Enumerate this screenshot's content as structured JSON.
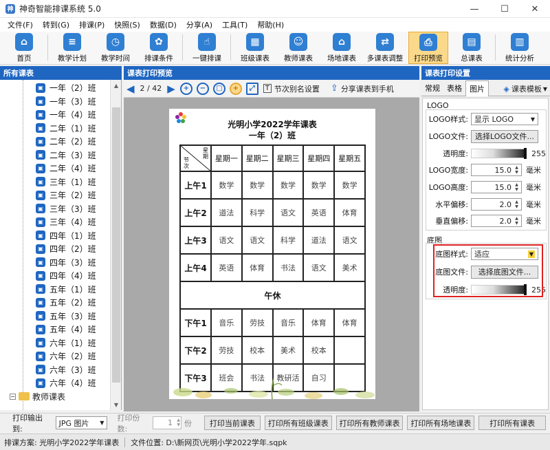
{
  "window": {
    "title": "神奇智能排课系统 5.0"
  },
  "menu": [
    "文件(F)",
    "转到(G)",
    "排课(P)",
    "快照(S)",
    "数据(D)",
    "分享(A)",
    "工具(T)",
    "帮助(H)"
  ],
  "toolbar": [
    {
      "label": "首页",
      "icon": "home-icon"
    },
    {
      "label": "教学计划",
      "icon": "plan-icon"
    },
    {
      "label": "教学时间",
      "icon": "clock-icon"
    },
    {
      "label": "排课条件",
      "icon": "conditions-icon"
    },
    {
      "label": "一键排课",
      "icon": "click-icon"
    },
    {
      "label": "班级课表",
      "icon": "class-schedule-icon"
    },
    {
      "label": "教师课表",
      "icon": "teacher-schedule-icon"
    },
    {
      "label": "场地课表",
      "icon": "venue-schedule-icon"
    },
    {
      "label": "多课表调整",
      "icon": "multi-adjust-icon"
    },
    {
      "label": "打印预览",
      "icon": "printer-icon"
    },
    {
      "label": "总课表",
      "icon": "total-schedule-icon"
    },
    {
      "label": "统计分析",
      "icon": "chart-icon"
    }
  ],
  "left": {
    "header": "所有课表",
    "classes": [
      "一年（2）班",
      "一年（3）班",
      "一年（4）班",
      "二年（1）班",
      "二年（2）班",
      "二年（3）班",
      "二年（4）班",
      "三年（1）班",
      "三年（2）班",
      "三年（3）班",
      "三年（4）班",
      "四年（1）班",
      "四年（2）班",
      "四年（3）班",
      "四年（4）班",
      "五年（1）班",
      "五年（2）班",
      "五年（3）班",
      "五年（4）班",
      "六年（1）班",
      "六年（2）班",
      "六年（3）班",
      "六年（4）班"
    ],
    "folder": "教师课表"
  },
  "preview": {
    "header": "课表打印预览",
    "page": "2 / 42",
    "alias_btn": "节次别名设置",
    "share_btn": "分享课表到手机",
    "title": "光明小学2022学年课表",
    "subtitle": "一年（2）班",
    "corner_top": "星\n期",
    "corner_bottom": "节\n次",
    "days": [
      "星期一",
      "星期二",
      "星期三",
      "星期四",
      "星期五"
    ],
    "rows": [
      {
        "period": "上午1",
        "cells": [
          "数学",
          "数学",
          "数学",
          "数学",
          "数学"
        ]
      },
      {
        "period": "上午2",
        "cells": [
          "道法",
          "科学",
          "语文",
          "英语",
          "体育"
        ]
      },
      {
        "period": "上午3",
        "cells": [
          "语文",
          "语文",
          "科学",
          "道法",
          "语文"
        ]
      },
      {
        "period": "上午4",
        "cells": [
          "英语",
          "体育",
          "书法",
          "语文",
          "美术"
        ]
      }
    ],
    "lunch": "午休",
    "rows_pm": [
      {
        "period": "下午1",
        "cells": [
          "音乐",
          "劳技",
          "音乐",
          "体育",
          "体育"
        ]
      },
      {
        "period": "下午2",
        "cells": [
          "劳技",
          "校本",
          "美术",
          "校本",
          ""
        ]
      },
      {
        "period": "下午3",
        "cells": [
          "班会",
          "书法",
          "教研活",
          "自习",
          ""
        ]
      }
    ]
  },
  "right": {
    "header": "课表打印设置",
    "tabs": [
      "常规",
      "表格",
      "图片"
    ],
    "template_btn": "课表模板",
    "logo_group": "LOGO",
    "logo_style_label": "LOGO样式:",
    "logo_style_value": "显示 LOGO",
    "logo_file_label": "LOGO文件:",
    "logo_file_btn": "选择LOGO文件...",
    "opacity_label": "透明度:",
    "opacity_value": "255",
    "logo_width_label": "LOGO宽度:",
    "logo_width_value": "15.0",
    "logo_height_label": "LOGO高度:",
    "logo_height_value": "15.0",
    "h_offset_label": "水平偏移:",
    "h_offset_value": "2.0",
    "v_offset_label": "垂直偏移:",
    "v_offset_value": "2.0",
    "unit": "毫米",
    "bg_group": "底图",
    "bg_style_label": "底图样式:",
    "bg_style_value": "适应",
    "bg_file_label": "底图文件:",
    "bg_file_btn": "选择底图文件...",
    "bg_opacity_label": "透明度:",
    "bg_opacity_value": "255"
  },
  "bottom": {
    "output_label": "打印输出到:",
    "output_value": "JPG 图片",
    "copies_label": "打印份数:",
    "copies_value": "1",
    "copies_unit": "份",
    "buttons": [
      "打印当前课表",
      "打印所有班级课表",
      "打印所有教师课表",
      "打印所有场地课表",
      "打印所有课表"
    ]
  },
  "status": {
    "scheme": "排课方案:  光明小学2022学年课表",
    "file": "文件位置:  D:\\新网页\\光明小学2022学年.sqpk"
  },
  "colors": {
    "accent": "#1f66c1",
    "highlight": "#e02020",
    "active": "#fbd98a"
  }
}
